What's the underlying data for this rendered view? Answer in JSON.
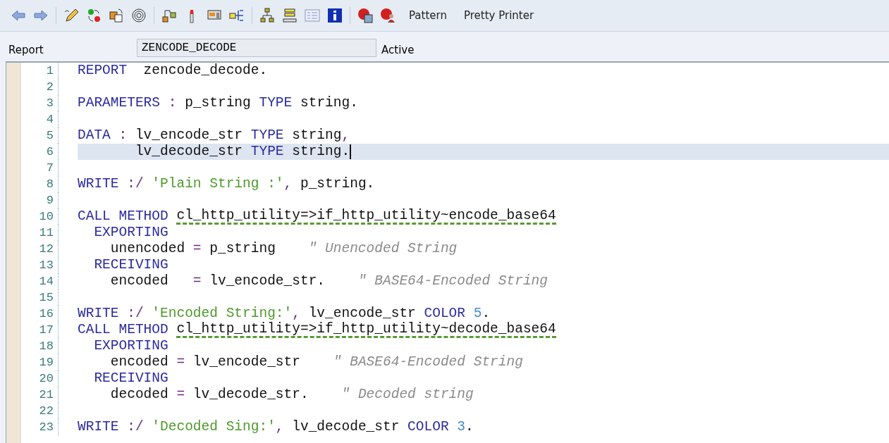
{
  "toolbar": {
    "buttons": [
      "Pattern",
      "Pretty Printer"
    ]
  },
  "header": {
    "label": "Report",
    "program": "ZENCODE_DECODE",
    "status": "Active"
  },
  "editor": {
    "lines": [
      {
        "number": "1",
        "selected": false,
        "tokens": [
          {
            "kind": "kw",
            "text": "REPORT"
          },
          {
            "kind": "plain",
            "text": "  zencode_decode."
          }
        ]
      },
      {
        "number": "2",
        "selected": false
      },
      {
        "number": "3",
        "selected": false,
        "tokens": [
          {
            "kind": "kw",
            "text": "PARAMETERS"
          },
          {
            "kind": "op",
            "text": " : "
          },
          {
            "kind": "plain",
            "text": "p_string "
          },
          {
            "kind": "kw",
            "text": "TYPE"
          },
          {
            "kind": "plain",
            "text": " string."
          }
        ]
      },
      {
        "number": "4",
        "selected": false
      },
      {
        "number": "5",
        "selected": false,
        "tokens": [
          {
            "kind": "kw",
            "text": "DATA"
          },
          {
            "kind": "op",
            "text": " : "
          },
          {
            "kind": "plain",
            "text": "lv_encode_str "
          },
          {
            "kind": "kw",
            "text": "TYPE"
          },
          {
            "kind": "plain",
            "text": " string"
          },
          {
            "kind": "op",
            "text": ","
          }
        ]
      },
      {
        "number": "6",
        "selected": true,
        "tokens": [
          {
            "kind": "plain",
            "text": "       lv_decode_str "
          },
          {
            "kind": "kw",
            "text": "TYPE"
          },
          {
            "kind": "plain",
            "text": " string."
          }
        ]
      },
      {
        "number": "7",
        "selected": false
      },
      {
        "number": "8",
        "selected": false,
        "tokens": [
          {
            "kind": "kw",
            "text": "WRITE"
          },
          {
            "kind": "op",
            "text": " :/ "
          },
          {
            "kind": "str",
            "text": "'Plain String :'"
          },
          {
            "kind": "op",
            "text": ", "
          },
          {
            "kind": "plain",
            "text": "p_string."
          }
        ]
      },
      {
        "number": "9",
        "selected": false
      },
      {
        "number": "10",
        "selected": false,
        "tokens": [
          {
            "kind": "kw",
            "text": "CALL METHOD "
          },
          {
            "kind": "plain",
            "text": "cl_http_utility=>if_http_utility~encode_base64",
            "underlined": true
          }
        ]
      },
      {
        "number": "11",
        "selected": false,
        "tokens": [
          {
            "kind": "kw",
            "text": "  EXPORTING"
          }
        ]
      },
      {
        "number": "12",
        "selected": false,
        "tokens": [
          {
            "kind": "plain",
            "text": "    unencoded "
          },
          {
            "kind": "op",
            "text": "="
          },
          {
            "kind": "plain",
            "text": " p_string    "
          },
          {
            "kind": "cmt",
            "text": "\" Unencoded String"
          }
        ]
      },
      {
        "number": "13",
        "selected": false,
        "tokens": [
          {
            "kind": "kw",
            "text": "  RECEIVING"
          }
        ]
      },
      {
        "number": "14",
        "selected": false,
        "tokens": [
          {
            "kind": "plain",
            "text": "    encoded   "
          },
          {
            "kind": "op",
            "text": "="
          },
          {
            "kind": "plain",
            "text": " lv_encode_str.    "
          },
          {
            "kind": "cmt",
            "text": "\" BASE64-Encoded String"
          }
        ]
      },
      {
        "number": "15",
        "selected": false
      },
      {
        "number": "16",
        "selected": false,
        "tokens": [
          {
            "kind": "kw",
            "text": "WRITE"
          },
          {
            "kind": "op",
            "text": " :/ "
          },
          {
            "kind": "str",
            "text": "'Encoded String:'"
          },
          {
            "kind": "op",
            "text": ", "
          },
          {
            "kind": "plain",
            "text": "lv_encode_str "
          },
          {
            "kind": "kw",
            "text": "COLOR"
          },
          {
            "kind": "num",
            "text": " 5"
          },
          {
            "kind": "plain",
            "text": "."
          }
        ]
      },
      {
        "number": "17",
        "selected": false,
        "tokens": [
          {
            "kind": "kw",
            "text": "CALL METHOD "
          },
          {
            "kind": "plain",
            "text": "cl_http_utility=>if_http_utility~decode_base64",
            "underlined": true
          }
        ]
      },
      {
        "number": "18",
        "selected": false,
        "tokens": [
          {
            "kind": "kw",
            "text": "  EXPORTING"
          }
        ]
      },
      {
        "number": "19",
        "selected": false,
        "tokens": [
          {
            "kind": "plain",
            "text": "    encoded "
          },
          {
            "kind": "op",
            "text": "="
          },
          {
            "kind": "plain",
            "text": " lv_encode_str    "
          },
          {
            "kind": "cmt",
            "text": "\" BASE64-Encoded String"
          }
        ]
      },
      {
        "number": "20",
        "selected": false,
        "tokens": [
          {
            "kind": "kw",
            "text": "  RECEIVING"
          }
        ]
      },
      {
        "number": "21",
        "selected": false,
        "tokens": [
          {
            "kind": "plain",
            "text": "    decoded "
          },
          {
            "kind": "op",
            "text": "="
          },
          {
            "kind": "plain",
            "text": " lv_decode_str.    "
          },
          {
            "kind": "cmt",
            "text": "\" Decoded string"
          }
        ]
      },
      {
        "number": "22",
        "selected": false
      },
      {
        "number": "23",
        "selected": false,
        "tokens": [
          {
            "kind": "kw",
            "text": "WRITE"
          },
          {
            "kind": "op",
            "text": " :/ "
          },
          {
            "kind": "str",
            "text": "'Decoded Sing:'"
          },
          {
            "kind": "op",
            "text": ", "
          },
          {
            "kind": "plain",
            "text": "lv_decode_str "
          },
          {
            "kind": "kw",
            "text": "COLOR"
          },
          {
            "kind": "num",
            "text": " 3"
          },
          {
            "kind": "plain",
            "text": "."
          }
        ]
      }
    ]
  }
}
